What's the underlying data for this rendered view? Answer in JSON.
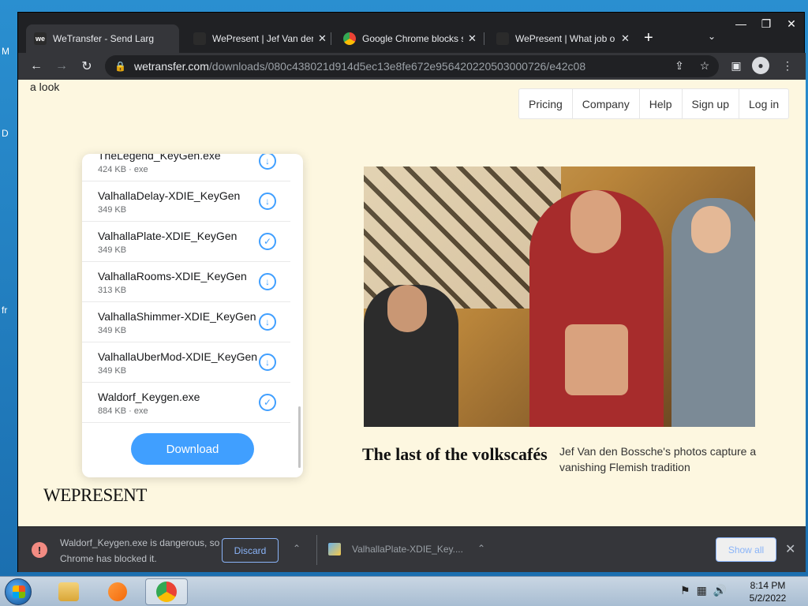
{
  "desktop": {
    "frag1": "M",
    "frag2": "D",
    "frag3": "fr"
  },
  "window_controls": {
    "minimize": "—",
    "maximize": "❐",
    "close": "✕"
  },
  "tabs": [
    {
      "title": "WeTransfer - Send Large",
      "close": "✕"
    },
    {
      "title": "WePresent | Jef Van den",
      "close": "✕"
    },
    {
      "title": "Google Chrome blocks s",
      "close": "✕"
    },
    {
      "title": "WePresent | What job o",
      "close": "✕"
    }
  ],
  "tabstrip": {
    "new_tab": "+",
    "tab_search": "⌄"
  },
  "toolbar": {
    "back": "←",
    "forward": "→",
    "reload": "↻",
    "url_host": "wetransfer.com",
    "url_path": "/downloads/080c438021d914d5ec13e8fe672e956420220503000726/e42c08",
    "share": "⇪",
    "star": "☆",
    "sidepanel": "▣",
    "menu": "⋮"
  },
  "page": {
    "peek_text": "a look",
    "nav": [
      "Pricing",
      "Company",
      "Help",
      "Sign up",
      "Log in"
    ],
    "files": [
      {
        "name": "TheLegend_KeyGen.exe",
        "meta": "424 KB · exe",
        "status": "download"
      },
      {
        "name": "ValhallaDelay-XDIE_KeyGen",
        "meta": "349 KB",
        "status": "download"
      },
      {
        "name": "ValhallaPlate-XDIE_KeyGen",
        "meta": "349 KB",
        "status": "done"
      },
      {
        "name": "ValhallaRooms-XDIE_KeyGen",
        "meta": "313 KB",
        "status": "download"
      },
      {
        "name": "ValhallaShimmer-XDIE_KeyGen",
        "meta": "349 KB",
        "status": "download"
      },
      {
        "name": "ValhallaUberMod-XDIE_KeyGen",
        "meta": "349 KB",
        "status": "download"
      },
      {
        "name": "Waldorf_Keygen.exe",
        "meta": "884 KB · exe",
        "status": "done"
      }
    ],
    "icons": {
      "download": "↓",
      "done": "✓"
    },
    "download_label": "Download",
    "brand": "WEPRESENT",
    "article_title": "The last of the volkscafés",
    "article_sub": "Jef Van den Bossche's photos capture a vanishing Flemish tradition"
  },
  "shelf": {
    "warning_icon": "!",
    "warning_text": "Waldorf_Keygen.exe is dangerous, so Chrome has blocked it.",
    "discard_label": "Discard",
    "chevron": "⌃",
    "item_name": "ValhallaPlate-XDIE_Key....",
    "show_all_label": "Show all",
    "close": "✕"
  },
  "taskbar": {
    "time": "8:14 PM",
    "date": "5/2/2022",
    "tray": {
      "flag": "⚑",
      "network": "▦",
      "volume": "🔊"
    }
  },
  "colors": {
    "accent": "#409fff",
    "page_bg": "#fdf7e0",
    "chrome_dark": "#35363a",
    "link_blue": "#8ab4f8"
  }
}
